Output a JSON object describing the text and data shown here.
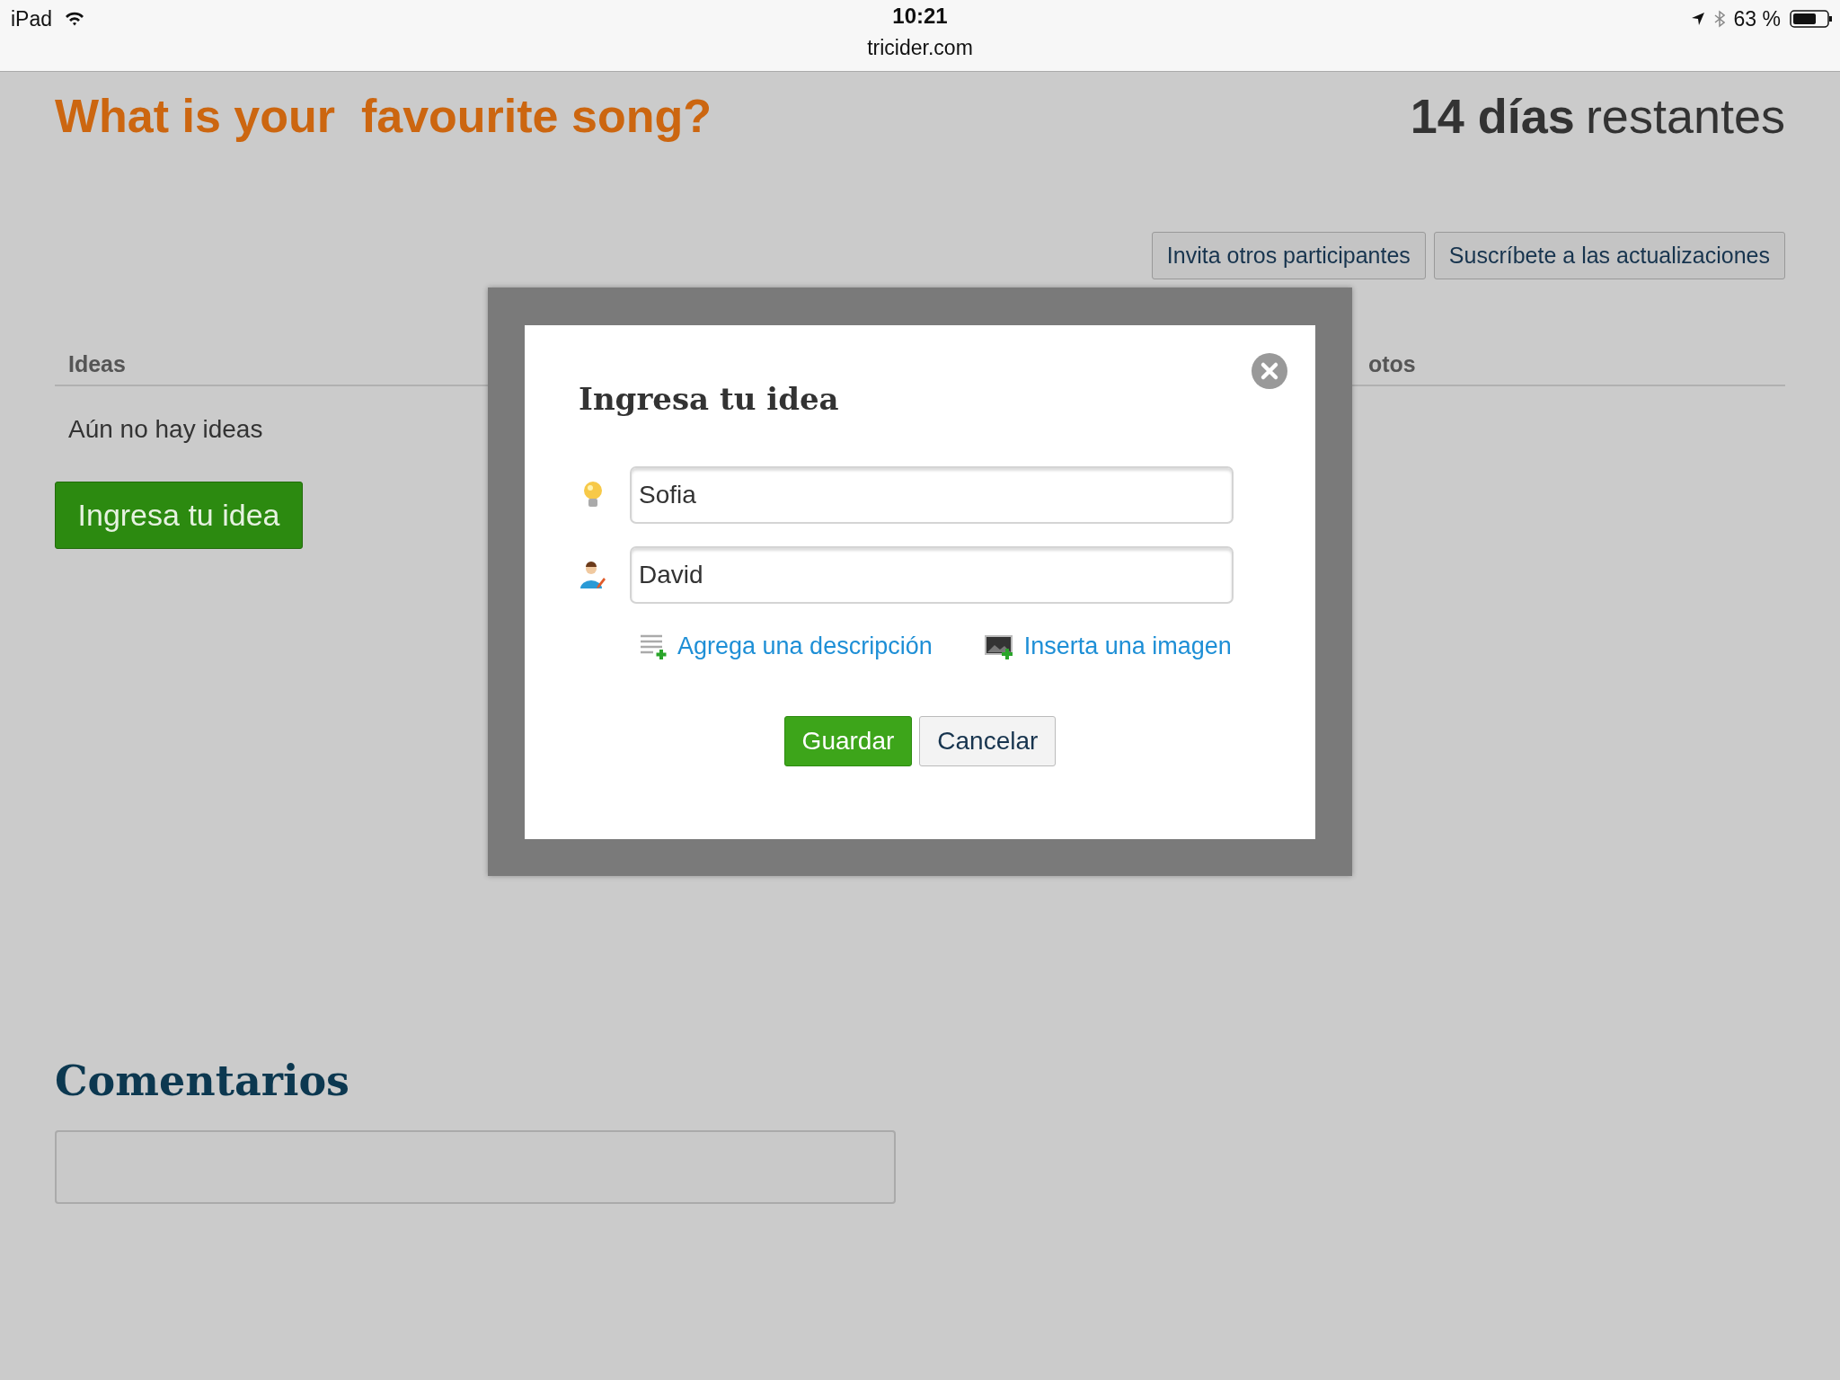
{
  "status_bar": {
    "device": "iPad",
    "time": "10:21",
    "url": "tricider.com",
    "battery": "63 %"
  },
  "page": {
    "title": "What is your  favourite song?",
    "days_count": "14 días",
    "days_label": "restantes",
    "actions": [
      "Invita otros participantes",
      "Suscríbete a las actualizaciones"
    ],
    "columns": [
      "Ideas",
      "otos"
    ],
    "empty_text": "Aún no hay ideas",
    "add_button": "Ingresa tu idea",
    "comments_title": "Comentarios"
  },
  "dialog": {
    "title": "Ingresa tu idea",
    "fields": [
      {
        "kind": "idea",
        "value": "Sofia"
      },
      {
        "kind": "author",
        "value": "David"
      }
    ],
    "links": [
      {
        "kind": "description",
        "label": "Agrega una descripción"
      },
      {
        "kind": "image",
        "label": "Inserta una imagen"
      }
    ],
    "save": "Guardar",
    "cancel": "Cancelar"
  }
}
